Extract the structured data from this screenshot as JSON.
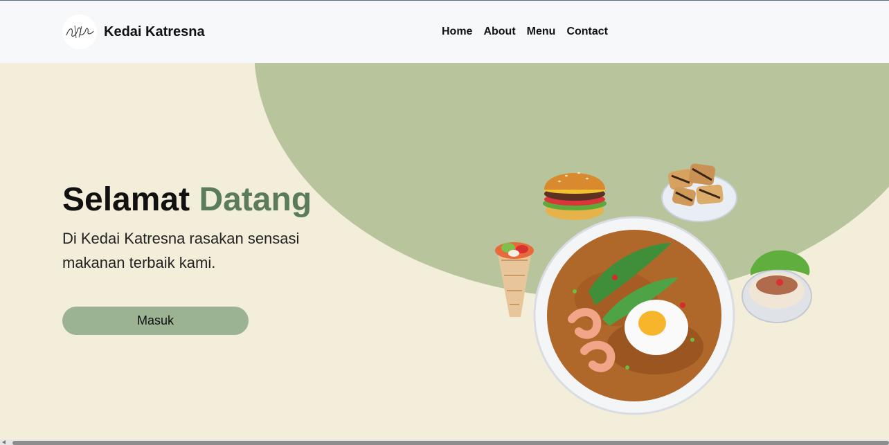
{
  "header": {
    "brand": "Kedai Katresna",
    "nav": [
      {
        "label": "Home"
      },
      {
        "label": "About"
      },
      {
        "label": "Menu"
      },
      {
        "label": "Contact"
      }
    ]
  },
  "hero": {
    "title_main": "Selamat",
    "title_accent": "Datang",
    "description": "Di Kedai Katresna rasakan sensasi makanan terbaik kami.",
    "button_label": "Masuk"
  },
  "colors": {
    "background": "#f2eed9",
    "accent": "#5b7c5a",
    "blob": "#b8c49b",
    "button": "#9bb393",
    "header": "#f7f8fa"
  }
}
